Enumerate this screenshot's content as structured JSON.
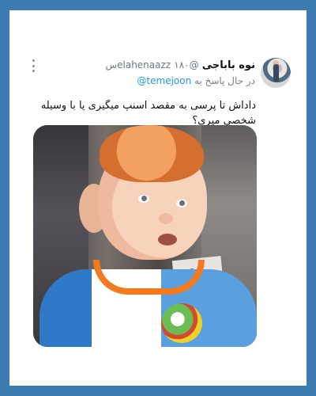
{
  "tweet": {
    "author_name": "نوه باباجی",
    "handle": "@elahenaazz",
    "time": "۱۸۰س",
    "reply_prefix": "در حال پاسخ به",
    "reply_to": "@temejoon",
    "text": "داداش تا پرسی به مقصد اسنپ میگیری یا با وسیله شخصی میری؟"
  }
}
